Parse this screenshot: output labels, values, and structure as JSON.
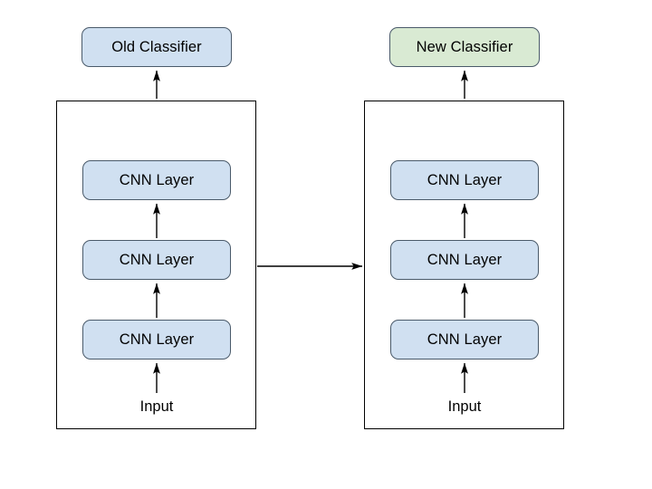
{
  "diagram": {
    "title_text_present": false,
    "background_color": "#ffffff",
    "left_stack": {
      "classifier": {
        "label": "Old Classifier",
        "fill_color": "#d0e0f1"
      },
      "layers": [
        {
          "label": "CNN Layer",
          "fill_color": "#d0e0f1"
        },
        {
          "label": "CNN Layer",
          "fill_color": "#d0e0f1"
        },
        {
          "label": "CNN Layer",
          "fill_color": "#d0e0f1"
        }
      ],
      "input_label": "Input"
    },
    "right_stack": {
      "classifier": {
        "label": "New Classifier",
        "fill_color": "#d9ead3"
      },
      "layers": [
        {
          "label": "CNN Layer",
          "fill_color": "#d0e0f1"
        },
        {
          "label": "CNN Layer",
          "fill_color": "#d0e0f1"
        },
        {
          "label": "CNN Layer",
          "fill_color": "#d0e0f1"
        }
      ],
      "input_label": "Input"
    },
    "transfer_arrow": {
      "label": "",
      "direction": "left-to-right"
    },
    "colors": {
      "box_blue": "#d0e0f1",
      "box_green": "#d9ead3",
      "box_border": "#4a5a6a",
      "container_border": "#000000",
      "arrow": "#000000",
      "text": "#000000"
    }
  }
}
